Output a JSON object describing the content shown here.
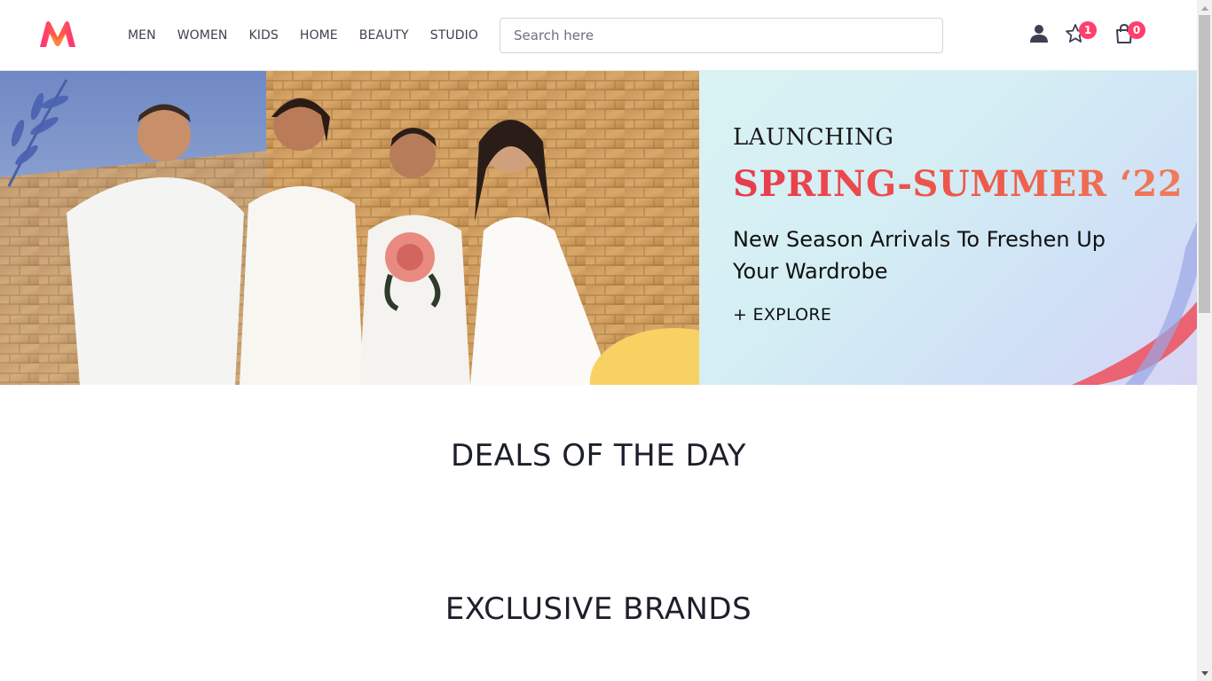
{
  "header": {
    "logo_name": "myntra-logo",
    "nav": [
      {
        "label": "MEN"
      },
      {
        "label": "WOMEN"
      },
      {
        "label": "KIDS"
      },
      {
        "label": "HOME"
      },
      {
        "label": "BEAUTY"
      },
      {
        "label": "STUDIO"
      }
    ],
    "search": {
      "placeholder": "Search here",
      "value": ""
    },
    "icons": {
      "profile": "user-icon",
      "wishlist": "star-icon",
      "bag": "shopping-bag-icon"
    },
    "wishlist_count": "1",
    "bag_count": "0"
  },
  "hero": {
    "launching": "LAUNCHING",
    "season": "SPRING-SUMMER ‘22",
    "subtitle": "New Season Arrivals To Freshen Up Your Wardrobe",
    "cta": "+ EXPLORE"
  },
  "sections": {
    "deals_title": "DEALS OF THE DAY",
    "brands_title": "EXCLUSIVE BRANDS"
  },
  "colors": {
    "brand_pink": "#ff3f6c",
    "season_red": "#e83b4e",
    "text_dark": "#282c3f"
  }
}
